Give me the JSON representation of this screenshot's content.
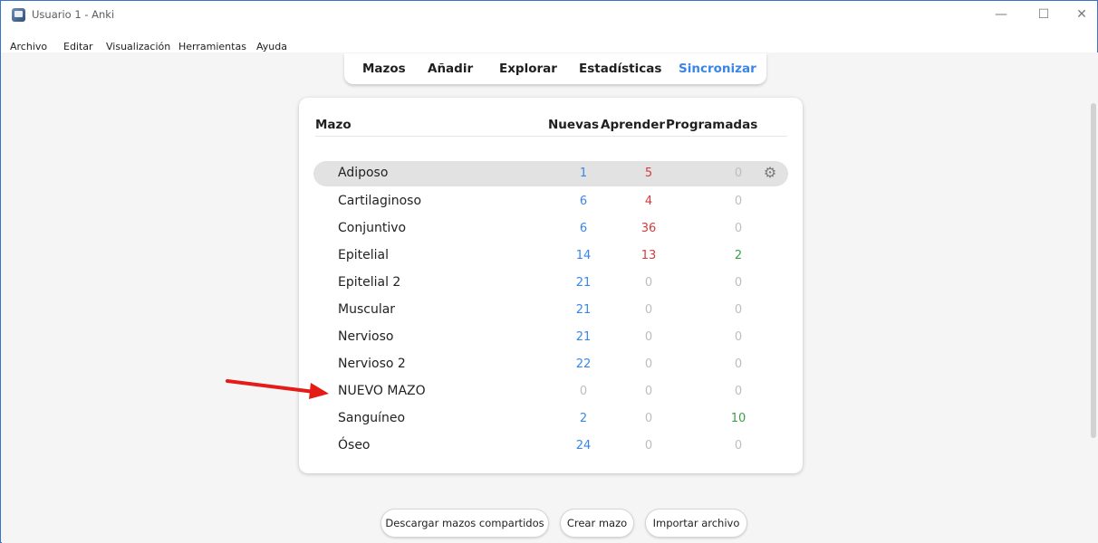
{
  "window": {
    "title": "Usuario 1 - Anki",
    "controls": {
      "minimize": "—",
      "maximize": "☐",
      "close": "✕"
    }
  },
  "menu": [
    "Archivo",
    "Editar",
    "Visualización",
    "Herramientas",
    "Ayuda"
  ],
  "toolbar": {
    "decks": "Mazos",
    "add": "Añadir",
    "browse": "Explorar",
    "stats": "Estadísticas",
    "sync": "Sincronizar"
  },
  "table": {
    "headers": {
      "deck": "Mazo",
      "new": "Nuevas",
      "learn": "Aprender",
      "due": "Programadas"
    },
    "rows": [
      {
        "name": "Adiposo",
        "new": "1",
        "learn": "5",
        "due": "0"
      },
      {
        "name": "Cartilaginoso",
        "new": "6",
        "learn": "4",
        "due": "0"
      },
      {
        "name": "Conjuntivo",
        "new": "6",
        "learn": "36",
        "due": "0"
      },
      {
        "name": "Epitelial",
        "new": "14",
        "learn": "13",
        "due": "2"
      },
      {
        "name": "Epitelial 2",
        "new": "21",
        "learn": "0",
        "due": "0"
      },
      {
        "name": "Muscular",
        "new": "21",
        "learn": "0",
        "due": "0"
      },
      {
        "name": "Nervioso",
        "new": "21",
        "learn": "0",
        "due": "0"
      },
      {
        "name": "Nervioso 2",
        "new": "22",
        "learn": "0",
        "due": "0"
      },
      {
        "name": "NUEVO MAZO",
        "new": "0",
        "learn": "0",
        "due": "0"
      },
      {
        "name": "Sanguíneo",
        "new": "2",
        "learn": "0",
        "due": "10"
      },
      {
        "name": "Óseo",
        "new": "24",
        "learn": "0",
        "due": "0"
      }
    ],
    "gear_icon": "gear-icon"
  },
  "buttons": {
    "shared": "Descargar mazos compartidos",
    "create": "Crear mazo",
    "import": "Importar archivo"
  },
  "colors": {
    "new": "#3a86e8",
    "learn": "#d33d3d",
    "due": "#3b9f4a",
    "zero": "#bdbdbd",
    "annotation_arrow": "#e41b17"
  }
}
